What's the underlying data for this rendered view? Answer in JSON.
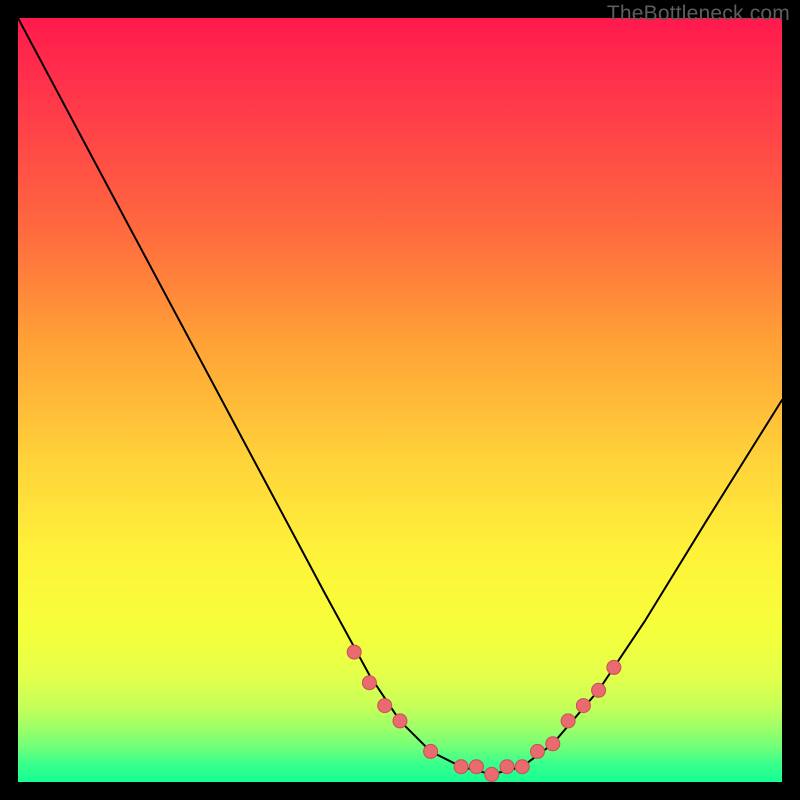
{
  "watermark": "TheBottleneck.com",
  "chart_data": {
    "type": "line",
    "title": "",
    "xlabel": "",
    "ylabel": "",
    "xlim": [
      0,
      100
    ],
    "ylim": [
      0,
      100
    ],
    "grid": false,
    "series": [
      {
        "name": "bottleneck-curve",
        "x": [
          0,
          8,
          16,
          24,
          32,
          40,
          46,
          50,
          54,
          58,
          62,
          66,
          70,
          76,
          82,
          90,
          100
        ],
        "y": [
          100,
          85,
          70,
          55,
          40,
          25,
          14,
          8,
          4,
          2,
          1,
          2,
          5,
          12,
          21,
          34,
          50
        ]
      }
    ],
    "markers": {
      "name": "highlight-dots",
      "x": [
        44,
        46,
        48,
        50,
        54,
        58,
        60,
        62,
        64,
        66,
        68,
        70,
        72,
        74,
        76,
        78
      ],
      "y": [
        17,
        13,
        10,
        8,
        4,
        2,
        2,
        1,
        2,
        2,
        4,
        5,
        8,
        10,
        12,
        15
      ]
    },
    "background_gradient": {
      "top": "#ff1a4d",
      "mid": "#fff23a",
      "bottom": "#14ff95"
    }
  }
}
